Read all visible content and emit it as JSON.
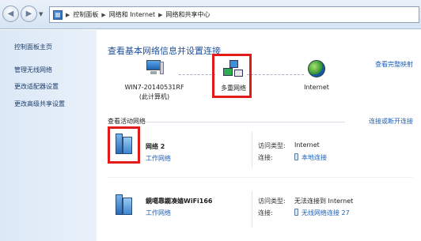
{
  "breadcrumb": {
    "items": [
      "控制面板",
      "网络和 Internet",
      "网络和共享中心"
    ],
    "separator": "▶"
  },
  "nav": {
    "back_icon": "back-arrow-icon",
    "forward_icon": "forward-arrow-icon"
  },
  "sidebar": {
    "items": [
      {
        "label": "控制面板主页"
      },
      {
        "label": "管理无线网络"
      },
      {
        "label": "更改适配器设置"
      },
      {
        "label": "更改高级共享设置"
      }
    ]
  },
  "main": {
    "title": "查看基本网络信息并设置连接",
    "view_map": "查看完整映射",
    "map": {
      "pc_label": "WIN7-20140531RF",
      "pc_sublabel": "(此计算机)",
      "multi_label": "多重网络",
      "internet_label": "Internet"
    },
    "active_label": "查看活动网络",
    "connect_link": "连接或断开连接",
    "networks": [
      {
        "name": "网络  2",
        "type": "工作网络",
        "access_key": "访问类型:",
        "access_value": "Internet",
        "conn_key": "连接:",
        "conn_value": "本地连接"
      },
      {
        "name": "鏡噶靠鐗凑嫱WiFi166",
        "type": "工作网络",
        "access_key": "访问类型:",
        "access_value": "无法连接到 Internet",
        "conn_key": "连接:",
        "conn_value": "无线网络连接 27"
      }
    ]
  },
  "colors": {
    "highlight": "#e21a1a",
    "title_blue": "#1e4f9b",
    "link_blue": "#1e5fb5"
  }
}
